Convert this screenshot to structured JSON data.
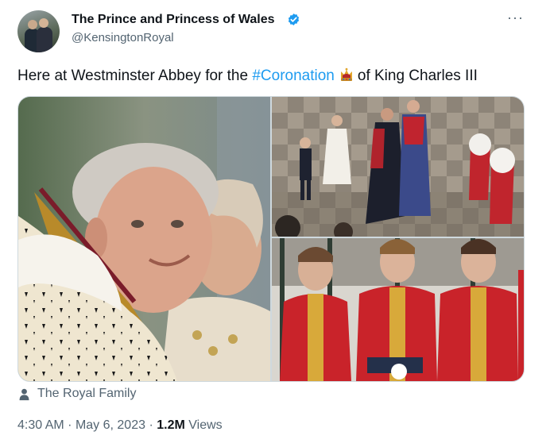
{
  "author": {
    "display_name": "The Prince and Princess of Wales",
    "handle": "@KensingtonRoyal",
    "verified_color": "#1d9bf0"
  },
  "tweet": {
    "text_before": "Here at Westminster Abbey for the ",
    "hashtag": "#Coronation",
    "emoji": "crown-emoji",
    "text_after": "of King Charles III"
  },
  "media": {
    "images": [
      {
        "subject": "king-and-queen-portrait"
      },
      {
        "subject": "abbey-procession"
      },
      {
        "subject": "pages-of-honour"
      }
    ]
  },
  "tagged": {
    "icon": "person-icon",
    "label": "The Royal Family"
  },
  "meta": {
    "time": "4:30 AM",
    "sep1": "·",
    "date": "May 6, 2023",
    "sep2": "·",
    "views_count": "1.2M",
    "views_label": "Views"
  },
  "colors": {
    "text": "#0f1419",
    "secondary": "#536471",
    "link": "#1d9bf0",
    "border": "#cfd9de"
  }
}
